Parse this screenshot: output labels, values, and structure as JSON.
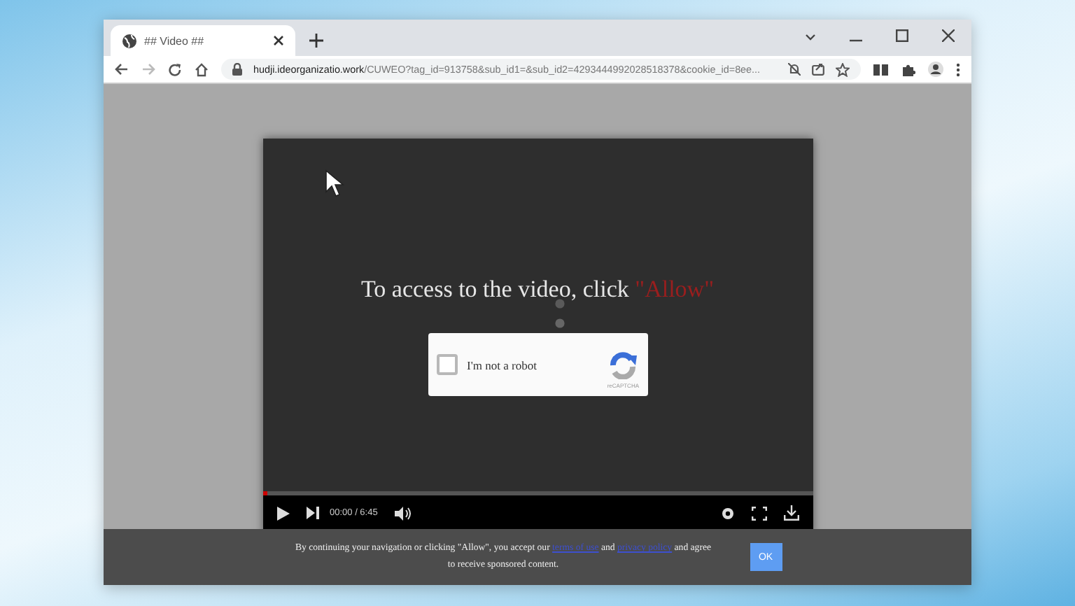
{
  "browser": {
    "tab": {
      "title": "## Video ##",
      "selected": true
    },
    "address": {
      "domain": "hudji.ideorganizatio.work",
      "path": "/CUWEO?tag_id=913758&sub_id1=&sub_id2=4293444992028518378&cookie_id=8ee..."
    }
  },
  "video": {
    "headline": "To access to the video, click ",
    "headline_highlight": "\"Allow\"",
    "captcha": {
      "label": "I'm not a robot",
      "checked": false,
      "brand": "reCAPTCHA"
    },
    "progress": {
      "level": 0.01
    },
    "time": "00:00 / 6:45"
  },
  "consent": {
    "text_before": "By continuing your navigation or clicking \"Allow\", you accept our ",
    "link_1": "terms of use",
    "middle": " and ",
    "link_2": "privacy policy",
    "text_after": " and agree to receive sponsored content.",
    "button": "OK"
  }
}
